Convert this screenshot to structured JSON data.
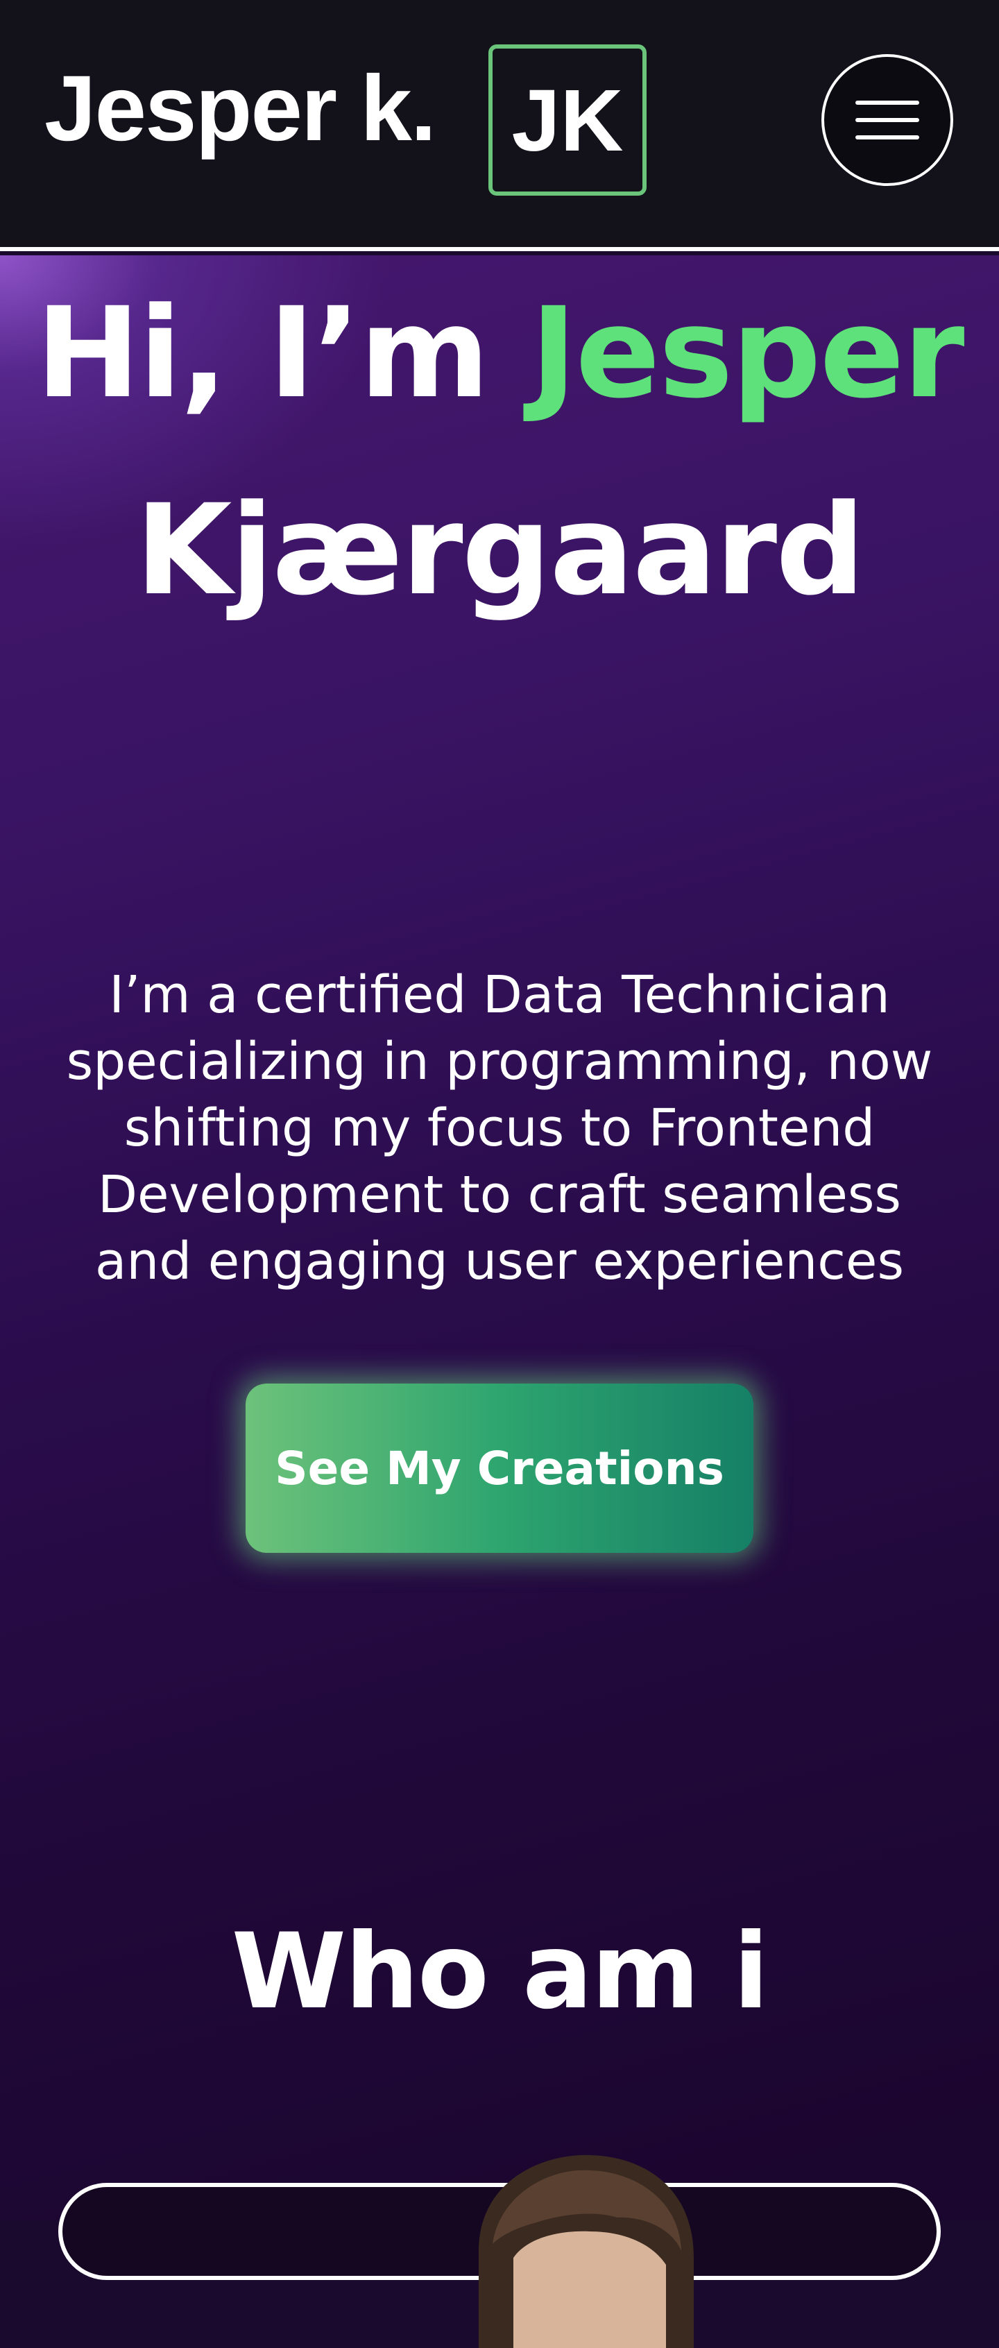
{
  "header": {
    "brand_name": "Jesper k.",
    "logo_text": "JK",
    "menu_icon": "hamburger-icon",
    "accent_color": "#6ac47a"
  },
  "hero": {
    "greeting": "Hi, I’m",
    "first_name": "Jesper",
    "last_name": "Kjærgaard",
    "name_color": "#5ee07a",
    "description": "I’m a certified Data Technician specializing in programming, now shifting my focus to Frontend Development to craft seamless and engaging user experiences",
    "cta_label": "See My Creations"
  },
  "about": {
    "title": "Who am i",
    "avatar_icon": "profile-photo"
  }
}
